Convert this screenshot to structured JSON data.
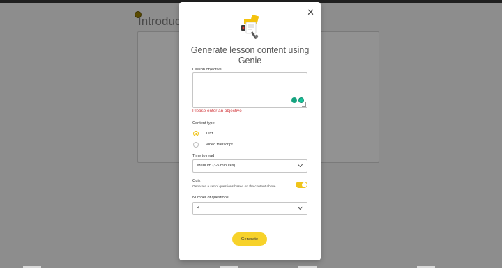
{
  "background": {
    "page_title": "Introducti"
  },
  "modal": {
    "close_glyph": "✕",
    "title": "Generate lesson content using Genie",
    "lesson_objective": {
      "label": "Lesson objective",
      "value": "",
      "error": "Please enter an objective"
    },
    "content_type": {
      "label": "Content type",
      "options": [
        {
          "label": "Text",
          "selected": true
        },
        {
          "label": "Video transcript",
          "selected": false
        }
      ]
    },
    "time_to_read": {
      "label": "Time to read",
      "value": "Medium (3-5 minutes)"
    },
    "quiz": {
      "label": "Quiz",
      "description": "Generate a set of questions based on the content above.",
      "enabled": true
    },
    "number_of_questions": {
      "label": "Number of questions",
      "value": "4"
    },
    "generate_label": "Generate"
  },
  "colors": {
    "accent": "#f7d22a",
    "error": "#d13438",
    "overlay": "#8f8f8f"
  }
}
